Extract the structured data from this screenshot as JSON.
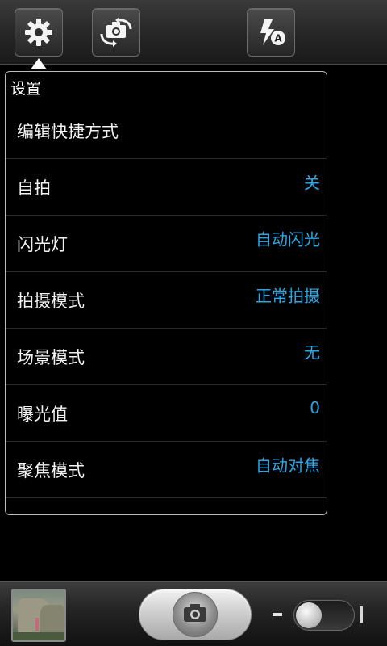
{
  "topbar": {
    "buttons": [
      {
        "id": "settings",
        "icon": "gear-icon"
      },
      {
        "id": "switch_camera",
        "icon": "camera-switch-icon"
      },
      {
        "id": "flash",
        "icon": "flash-auto-icon",
        "badge": "A"
      }
    ]
  },
  "settings_panel": {
    "title": "设置",
    "rows": [
      {
        "label": "编辑快捷方式",
        "value": ""
      },
      {
        "label": "自拍",
        "value": "关"
      },
      {
        "label": "闪光灯",
        "value": "自动闪光"
      },
      {
        "label": "拍摄模式",
        "value": "正常拍摄"
      },
      {
        "label": "场景模式",
        "value": "无"
      },
      {
        "label": "曝光值",
        "value": "0"
      },
      {
        "label": "聚焦模式",
        "value": "自动对焦"
      }
    ]
  },
  "bottombar": {
    "thumbnail": "last-photo-thumbnail",
    "shutter_icon": "camera-icon",
    "mode_toggle": "camera-video-toggle"
  },
  "colors": {
    "accent_value": "#2aa6e6",
    "panel_border": "#bdbdbd",
    "background": "#000000"
  }
}
